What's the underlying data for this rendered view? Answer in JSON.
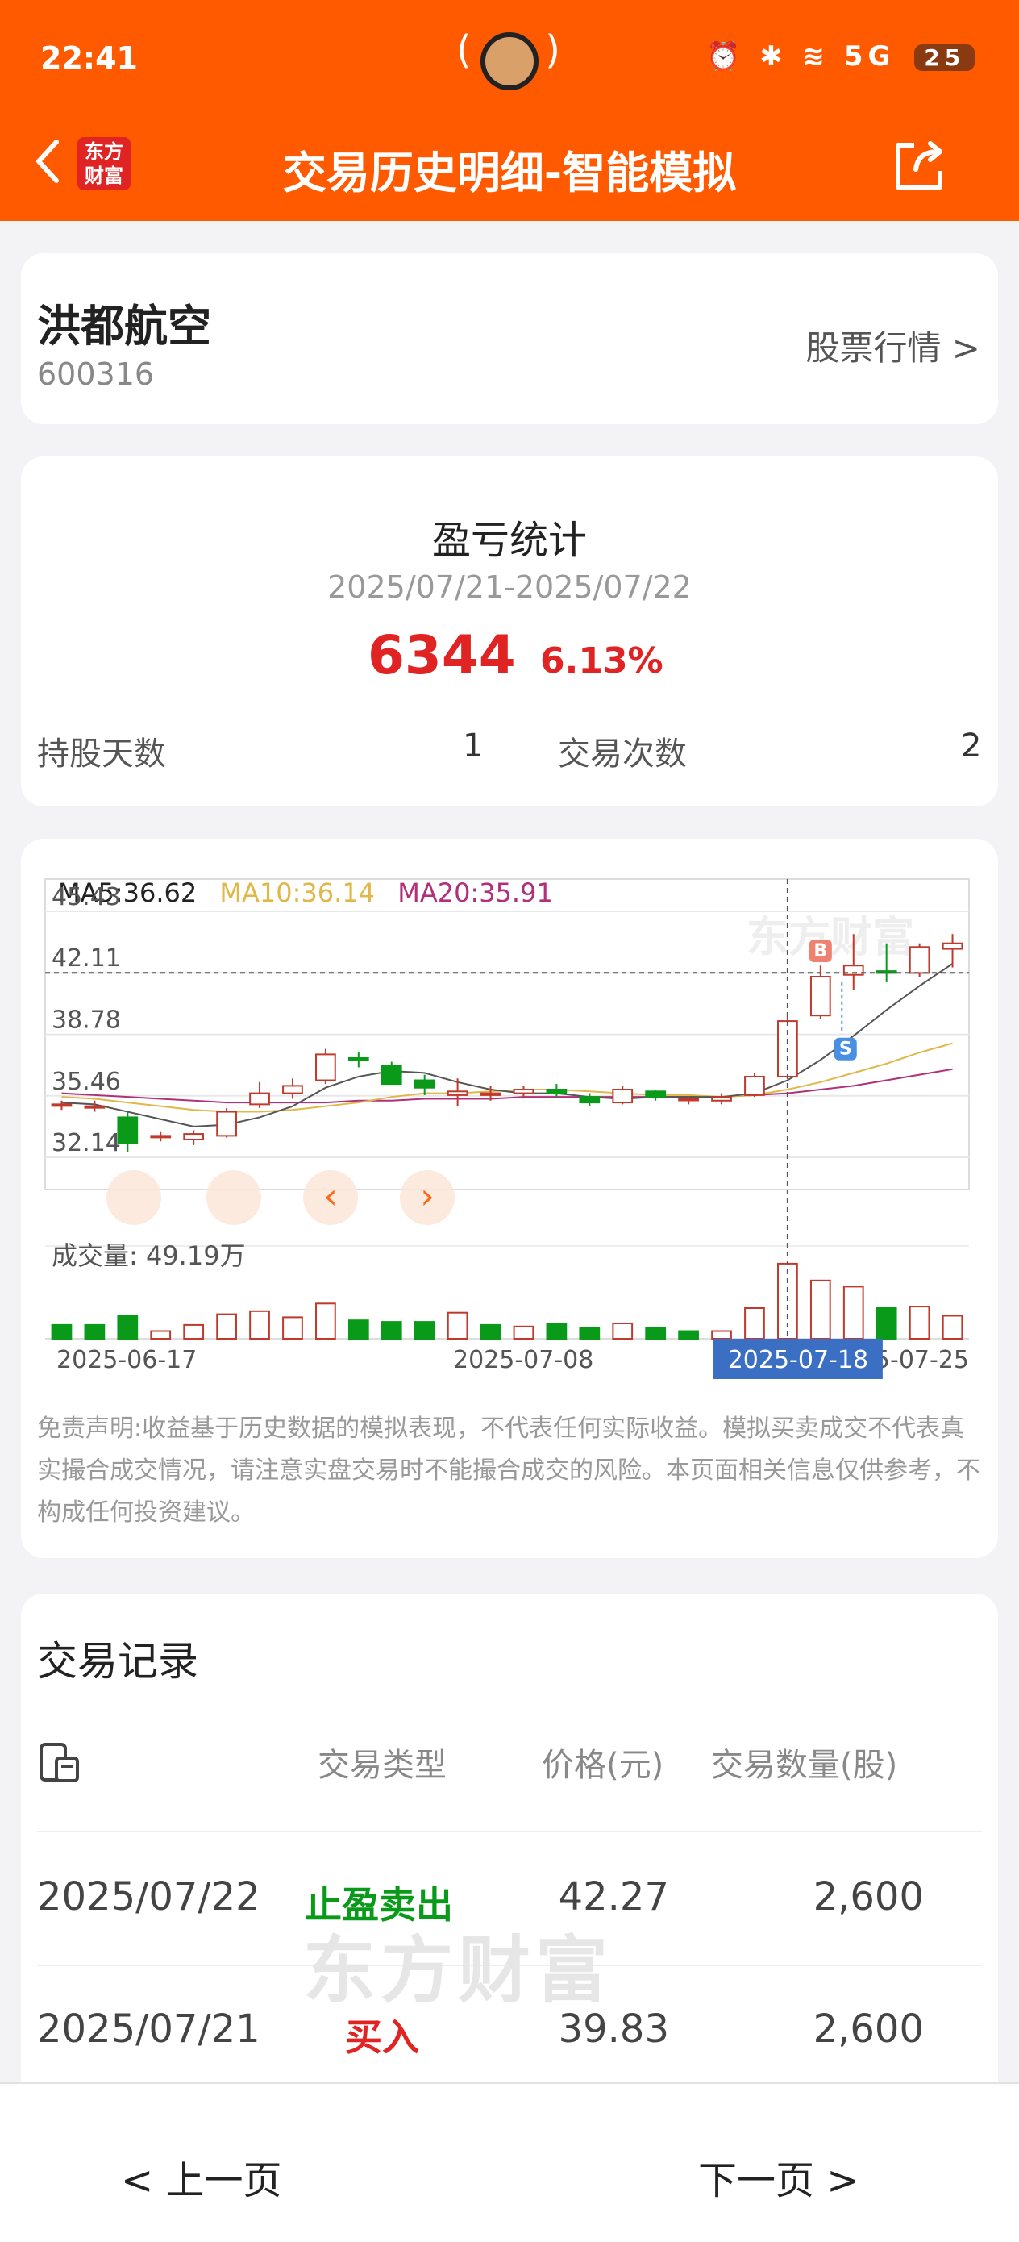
{
  "status": {
    "time": "22:41",
    "battery": "25",
    "network": "5G"
  },
  "header": {
    "title": "交易历史明细-智能模拟",
    "logo_line1": "东方",
    "logo_line2": "财富"
  },
  "stock": {
    "name": "洪都航空",
    "code": "600316",
    "quote_link": "股票行情 >"
  },
  "pnl": {
    "title": "盈亏统计",
    "range": "2025/07/21-2025/07/22",
    "amount": "6344",
    "percent": "6.13%",
    "hold_days_label": "持股天数",
    "hold_days": "1",
    "trade_count_label": "交易次数",
    "trade_count": "2"
  },
  "chart": {
    "ma5": "MA5:36.62",
    "ma10": "MA10:36.14",
    "ma20": "MA20:35.91",
    "volume_label": "成交量: 49.19万",
    "watermark": "东方财富",
    "buy_marker": "B",
    "sell_marker": "S",
    "crosshair_date": "2025-07-18",
    "colors": {
      "up": "#c0392b",
      "down": "#0a9a1a",
      "ma5": "#555555",
      "ma10": "#e0b84a",
      "ma20": "#b0307a"
    }
  },
  "chart_data": {
    "type": "candlestick",
    "y_ticks": [
      "45.43",
      "42.11",
      "38.78",
      "35.46",
      "32.14"
    ],
    "ylim": [
      32.14,
      45.43
    ],
    "x_tick_labels": [
      "2025-06-17",
      "2025-07-08",
      "25-07-25"
    ],
    "candles": [
      {
        "o": 35.0,
        "h": 35.2,
        "l": 34.7,
        "c": 35.0
      },
      {
        "o": 34.9,
        "h": 35.2,
        "l": 34.6,
        "c": 34.9
      },
      {
        "o": 34.3,
        "h": 34.6,
        "l": 32.4,
        "c": 32.9
      },
      {
        "o": 33.3,
        "h": 33.5,
        "l": 33.0,
        "c": 33.3
      },
      {
        "o": 33.1,
        "h": 33.6,
        "l": 32.8,
        "c": 33.4
      },
      {
        "o": 33.3,
        "h": 34.8,
        "l": 33.2,
        "c": 34.6
      },
      {
        "o": 35.0,
        "h": 36.2,
        "l": 34.8,
        "c": 35.6
      },
      {
        "o": 35.6,
        "h": 36.4,
        "l": 35.3,
        "c": 36.0
      },
      {
        "o": 36.3,
        "h": 38.0,
        "l": 36.1,
        "c": 37.7
      },
      {
        "o": 37.5,
        "h": 37.8,
        "l": 37.0,
        "c": 37.4
      },
      {
        "o": 37.1,
        "h": 37.3,
        "l": 36.1,
        "c": 36.1
      },
      {
        "o": 36.3,
        "h": 36.6,
        "l": 35.5,
        "c": 35.9
      },
      {
        "o": 35.5,
        "h": 36.4,
        "l": 34.9,
        "c": 35.7
      },
      {
        "o": 35.5,
        "h": 36.0,
        "l": 35.2,
        "c": 35.6
      },
      {
        "o": 35.6,
        "h": 36.0,
        "l": 35.4,
        "c": 35.8
      },
      {
        "o": 35.8,
        "h": 36.1,
        "l": 35.4,
        "c": 35.6
      },
      {
        "o": 35.4,
        "h": 35.6,
        "l": 34.9,
        "c": 35.1
      },
      {
        "o": 35.1,
        "h": 36.0,
        "l": 35.0,
        "c": 35.8
      },
      {
        "o": 35.7,
        "h": 35.8,
        "l": 35.2,
        "c": 35.4
      },
      {
        "o": 35.3,
        "h": 35.4,
        "l": 35.0,
        "c": 35.3
      },
      {
        "o": 35.2,
        "h": 35.6,
        "l": 35.0,
        "c": 35.4
      },
      {
        "o": 35.5,
        "h": 36.7,
        "l": 35.4,
        "c": 36.5
      },
      {
        "o": 36.5,
        "h": 39.8,
        "l": 36.4,
        "c": 39.5
      },
      {
        "o": 39.8,
        "h": 42.5,
        "l": 39.6,
        "c": 41.9
      },
      {
        "o": 42.0,
        "h": 44.2,
        "l": 41.2,
        "c": 42.5
      },
      {
        "o": 42.2,
        "h": 43.7,
        "l": 41.6,
        "c": 42.1
      },
      {
        "o": 42.1,
        "h": 43.7,
        "l": 41.9,
        "c": 43.5
      },
      {
        "o": 43.4,
        "h": 44.2,
        "l": 42.4,
        "c": 43.7
      }
    ],
    "volume": [
      {
        "v": 9,
        "up": false
      },
      {
        "v": 9,
        "up": false
      },
      {
        "v": 15,
        "up": false
      },
      {
        "v": 5,
        "up": true
      },
      {
        "v": 9,
        "up": true
      },
      {
        "v": 16,
        "up": true
      },
      {
        "v": 18,
        "up": true
      },
      {
        "v": 14,
        "up": true
      },
      {
        "v": 23,
        "up": true
      },
      {
        "v": 12,
        "up": false
      },
      {
        "v": 11,
        "up": false
      },
      {
        "v": 11,
        "up": false
      },
      {
        "v": 17,
        "up": true
      },
      {
        "v": 9,
        "up": false
      },
      {
        "v": 8,
        "up": true
      },
      {
        "v": 10,
        "up": false
      },
      {
        "v": 7,
        "up": false
      },
      {
        "v": 10,
        "up": true
      },
      {
        "v": 7,
        "up": false
      },
      {
        "v": 5,
        "up": false
      },
      {
        "v": 5,
        "up": true
      },
      {
        "v": 20,
        "up": true
      },
      {
        "v": 49,
        "up": true
      },
      {
        "v": 38,
        "up": true
      },
      {
        "v": 34,
        "up": true
      },
      {
        "v": 20,
        "up": false
      },
      {
        "v": 21,
        "up": true
      },
      {
        "v": 15,
        "up": true
      }
    ],
    "ma5": [
      35.1,
      35.0,
      34.6,
      34.2,
      33.8,
      33.9,
      34.3,
      34.9,
      35.9,
      36.5,
      36.8,
      36.7,
      36.2,
      35.8,
      35.6,
      35.6,
      35.4,
      35.3,
      35.4,
      35.4,
      35.4,
      35.6,
      36.3,
      37.4,
      38.7,
      40.1,
      41.4,
      42.6
    ],
    "ma10": [
      35.4,
      35.3,
      35.1,
      34.9,
      34.7,
      34.6,
      34.6,
      34.7,
      34.9,
      35.1,
      35.4,
      35.6,
      35.6,
      35.7,
      35.8,
      35.8,
      35.7,
      35.6,
      35.5,
      35.5,
      35.4,
      35.5,
      35.8,
      36.2,
      36.7,
      37.2,
      37.8,
      38.3
    ],
    "ma20": [
      35.6,
      35.5,
      35.4,
      35.3,
      35.2,
      35.1,
      35.1,
      35.1,
      35.1,
      35.2,
      35.2,
      35.3,
      35.3,
      35.3,
      35.4,
      35.4,
      35.4,
      35.4,
      35.4,
      35.4,
      35.4,
      35.5,
      35.6,
      35.8,
      36.0,
      36.3,
      36.6,
      36.9
    ]
  },
  "disclaimer": "免责声明:收益基于历史数据的模拟表现，不代表任何实际收益。模拟买卖成交不代表真实撮合成交情况，请注意实盘交易时不能撮合成交的风险。本页面相关信息仅供参考，不构成任何投资建议。",
  "records": {
    "title": "交易记录",
    "headers": {
      "type": "交易类型",
      "price": "价格(元)",
      "qty": "交易数量(股)"
    },
    "rows": [
      {
        "date": "2025/07/22",
        "type": "止盈卖出",
        "type_color": "#0a9a1a",
        "price": "42.27",
        "qty": "2,600"
      },
      {
        "date": "2025/07/21",
        "type": "买入",
        "type_color": "#e02424",
        "price": "39.83",
        "qty": "2,600"
      }
    ],
    "watermark": "东方财富"
  },
  "footer": {
    "prev": "<   上一页",
    "next": "下一页   >"
  }
}
